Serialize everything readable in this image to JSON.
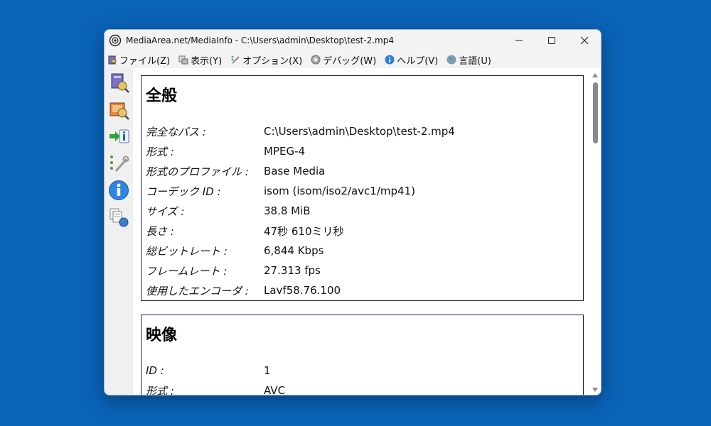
{
  "window": {
    "title": "MediaArea.net/MediaInfo - C:\\Users\\admin\\Desktop\\test-2.mp4",
    "minimize": "—",
    "maximize": "☐",
    "close": "✕"
  },
  "menu": [
    {
      "label": "ファイル(Z)",
      "icon": "file-icon"
    },
    {
      "label": "表示(Y)",
      "icon": "view-icon"
    },
    {
      "label": "オプション(X)",
      "icon": "options-icon"
    },
    {
      "label": "デバッグ(W)",
      "icon": "debug-icon"
    },
    {
      "label": "ヘルプ(V)",
      "icon": "help-icon"
    },
    {
      "label": "言語(U)",
      "icon": "language-icon"
    }
  ],
  "toolbar": [
    {
      "icon": "open-file-icon"
    },
    {
      "icon": "open-folder-icon"
    },
    {
      "icon": "export-icon"
    },
    {
      "icon": "preferences-icon"
    },
    {
      "icon": "about-icon"
    },
    {
      "icon": "knowledge-base-icon"
    }
  ],
  "sections": [
    {
      "title": "全般",
      "rows": [
        {
          "key": "完全なパス :",
          "value": "C:\\Users\\admin\\Desktop\\test-2.mp4"
        },
        {
          "key": "形式 :",
          "value": "MPEG-4"
        },
        {
          "key": "形式のプロファイル :",
          "value": "Base Media"
        },
        {
          "key": "コーデック ID :",
          "value": "isom (isom/iso2/avc1/mp41)"
        },
        {
          "key": "サイズ :",
          "value": "38.8 MiB"
        },
        {
          "key": "長さ :",
          "value": "47秒 610ミリ秒"
        },
        {
          "key": "総ビットレート :",
          "value": "6,844 Kbps"
        },
        {
          "key": "フレームレート :",
          "value": "27.313 fps"
        },
        {
          "key": "使用したエンコーダ :",
          "value": "Lavf58.76.100"
        }
      ]
    },
    {
      "title": "映像",
      "rows": [
        {
          "key": "ID :",
          "value": "1"
        },
        {
          "key": "形式 :",
          "value": "AVC"
        }
      ]
    }
  ],
  "colors": {
    "desktop": "#0a63b8",
    "section_border": "#1a1a6e"
  }
}
